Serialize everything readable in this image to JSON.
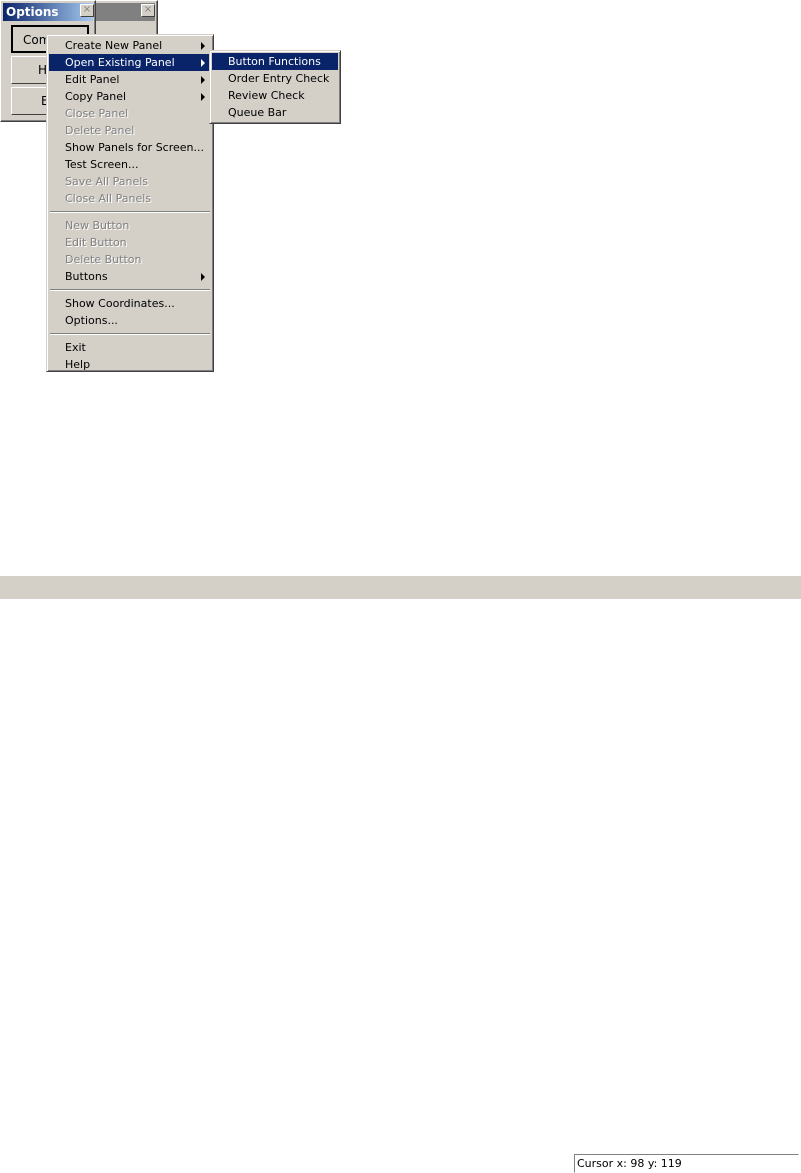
{
  "windows": {
    "back": {
      "close": "×"
    },
    "options": {
      "title": "Options",
      "close": "×",
      "buttons": [
        "Com",
        "H",
        "E"
      ]
    }
  },
  "menu": {
    "items": [
      {
        "label": "Create New Panel",
        "submenu": true,
        "enabled": true
      },
      {
        "label": "Open Existing Panel",
        "submenu": true,
        "enabled": true,
        "selected": true
      },
      {
        "label": "Edit Panel",
        "submenu": true,
        "enabled": true
      },
      {
        "label": "Copy Panel",
        "submenu": true,
        "enabled": true
      },
      {
        "label": "Close Panel",
        "enabled": false
      },
      {
        "label": "Delete Panel",
        "enabled": false
      },
      {
        "label": "Show Panels for Screen...",
        "enabled": true
      },
      {
        "label": "Test Screen...",
        "enabled": true
      },
      {
        "label": "Save All Panels",
        "enabled": false
      },
      {
        "label": "Close All Panels",
        "enabled": false
      },
      {
        "separator": true
      },
      {
        "label": "New Button",
        "enabled": false
      },
      {
        "label": "Edit Button",
        "enabled": false
      },
      {
        "label": "Delete Button",
        "enabled": false
      },
      {
        "label": "Buttons",
        "submenu": true,
        "enabled": true
      },
      {
        "separator": true
      },
      {
        "label": "Show Coordinates...",
        "enabled": true
      },
      {
        "label": "Options...",
        "enabled": true
      },
      {
        "separator": true
      },
      {
        "label": "Exit",
        "enabled": true
      },
      {
        "label": "Help",
        "enabled": true
      }
    ]
  },
  "submenu": {
    "items": [
      {
        "label": "Button Functions",
        "selected": true
      },
      {
        "label": "Order Entry Check"
      },
      {
        "label": "Review Check"
      },
      {
        "label": "Queue Bar"
      }
    ]
  },
  "status": {
    "cursor": "Cursor x: 98  y: 119"
  }
}
